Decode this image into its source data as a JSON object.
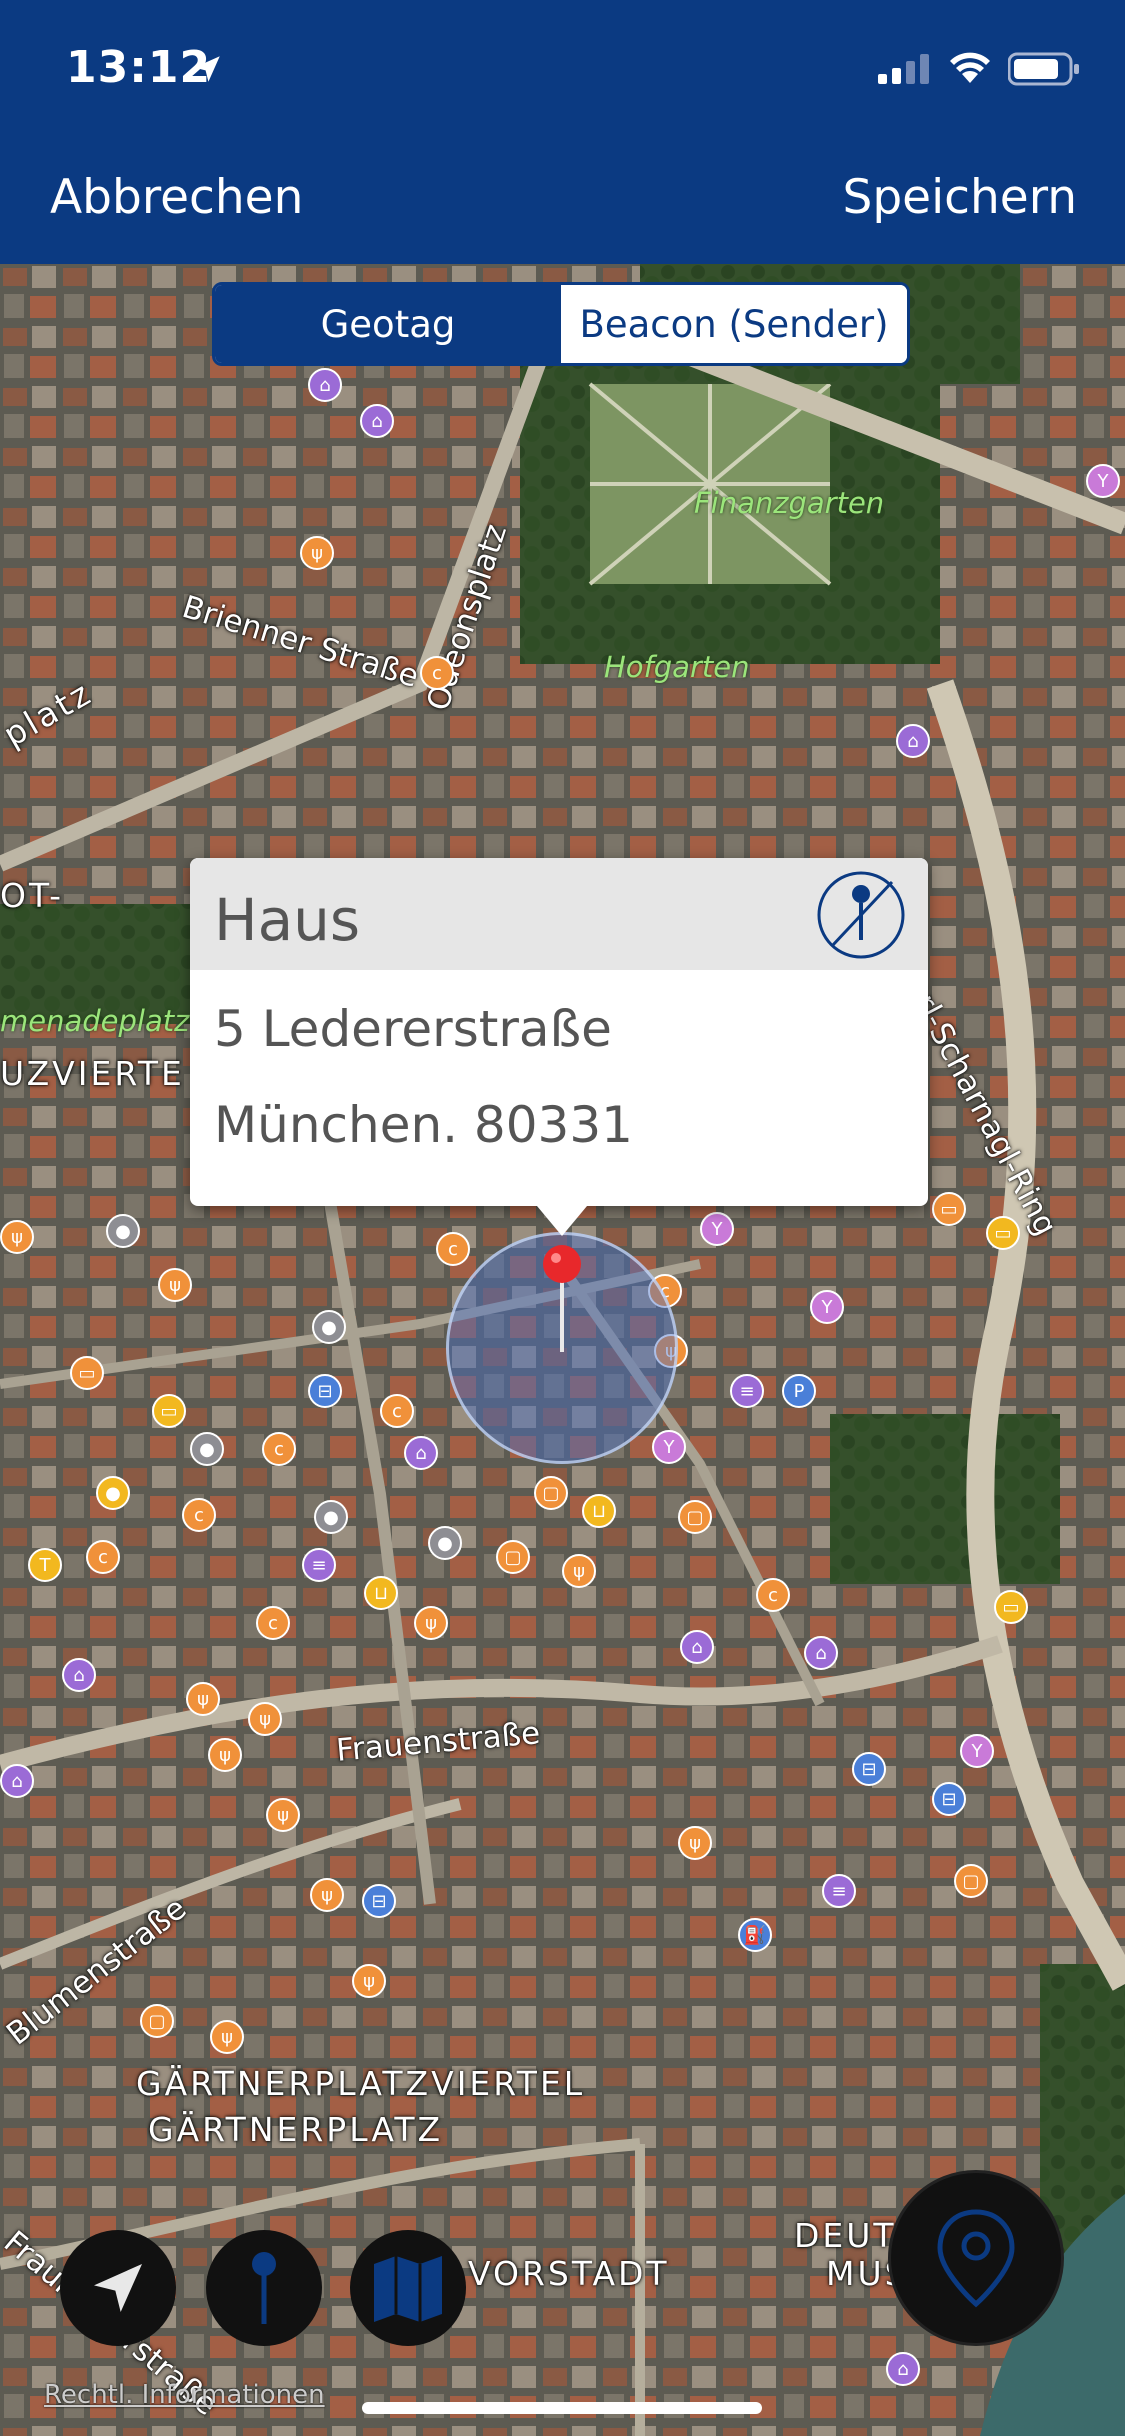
{
  "status_bar": {
    "time": "13:12"
  },
  "nav": {
    "cancel_label": "Abbrechen",
    "save_label": "Speichern"
  },
  "segmented": {
    "options": [
      "Geotag",
      "Beacon (Sender)"
    ],
    "selected": "Geotag"
  },
  "callout": {
    "title": "Haus",
    "street": "5 Ledererstraße",
    "city_line": "München. 80331"
  },
  "map": {
    "streets": [
      "Brienner Straße",
      "Odeonsplatz",
      "Karl-Scharnagl-Ring",
      "Frauenstraße",
      "Blumenstraße",
      "Fraunhoferstraße"
    ],
    "parks": [
      "Finanzgarten",
      "Hofgarten",
      "menadeplatz"
    ],
    "districts": [
      "GÄRTNERPLATZVIERTEL",
      "GÄRTNERPLATZ",
      "VORSTADT",
      "UZVIERTE",
      "DEUTSCHES",
      "MUSEUM",
      "platz",
      "OT-"
    ],
    "legal": "Rechtl. Informationen"
  },
  "colors": {
    "nav_bar": "#0b3a82",
    "accent": "#0b3a82",
    "pin": "#e8282b"
  }
}
